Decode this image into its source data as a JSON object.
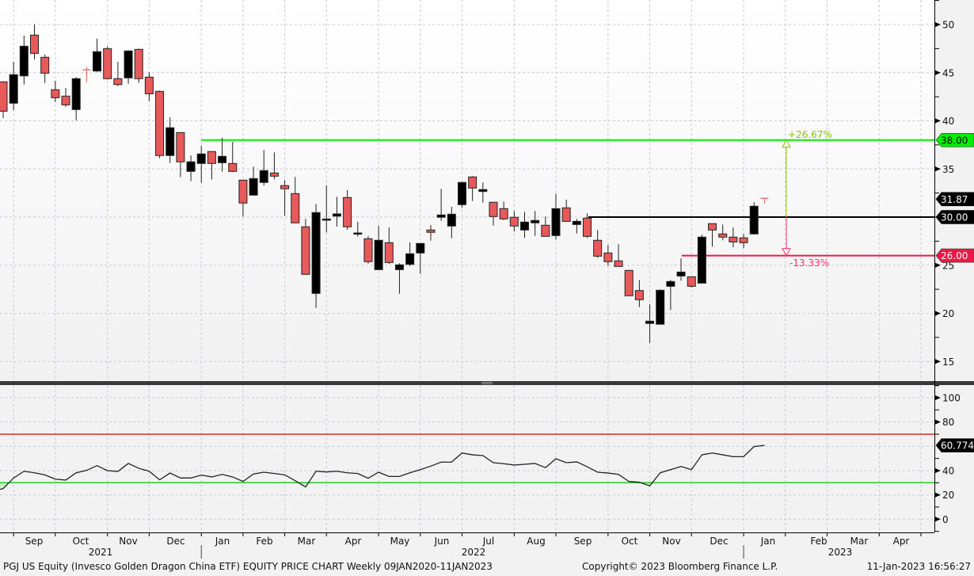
{
  "chart_data": {
    "type": "candlestick",
    "security": "PGJ US Equity (Invesco Golden Dragon China ETF)",
    "frequency": "Weekly",
    "price_panel": {
      "ylim": [
        12.5,
        52.5
      ],
      "y_ticks": [
        "50",
        "45",
        "40",
        "35",
        "25",
        "20",
        "15"
      ],
      "ohlc_columns": [
        "open",
        "high",
        "low",
        "close"
      ],
      "candles": [
        [
          44.05,
          44.1,
          40.3,
          41.0
        ],
        [
          41.83,
          46.13,
          41.11,
          44.79
        ],
        [
          44.67,
          48.85,
          43.77,
          47.75
        ],
        [
          48.9,
          50.0,
          46.4,
          47.01
        ],
        [
          46.6,
          46.87,
          43.93,
          44.95
        ],
        [
          43.23,
          44.16,
          41.96,
          42.4
        ],
        [
          42.57,
          43.42,
          41.46,
          41.66
        ],
        [
          41.17,
          44.54,
          40.04,
          44.38
        ],
        [
          45.3,
          45.6,
          44.0,
          45.25
        ],
        [
          45.17,
          48.52,
          45.09,
          47.18
        ],
        [
          47.5,
          47.75,
          44.3,
          44.38
        ],
        [
          44.38,
          46.13,
          43.6,
          43.77
        ],
        [
          44.46,
          47.3,
          43.85,
          47.26
        ],
        [
          47.42,
          47.5,
          43.93,
          44.38
        ],
        [
          44.54,
          45.04,
          42.04,
          42.81
        ],
        [
          43.06,
          43.14,
          36.12,
          36.4
        ],
        [
          36.4,
          40.37,
          35.62,
          39.28
        ],
        [
          38.78,
          38.8,
          34.14,
          35.74
        ],
        [
          34.75,
          36.4,
          33.73,
          35.74
        ],
        [
          35.57,
          37.41,
          33.56,
          36.56
        ],
        [
          36.81,
          36.81,
          33.9,
          35.57
        ],
        [
          35.65,
          38.23,
          34.72,
          36.31
        ],
        [
          35.57,
          37.82,
          34.67,
          34.75
        ],
        [
          33.84,
          33.84,
          30.06,
          31.46
        ],
        [
          32.28,
          35.24,
          32.28,
          34.0
        ],
        [
          33.6,
          36.97,
          33.27,
          34.83
        ],
        [
          34.58,
          36.72,
          33.93,
          34.25
        ],
        [
          33.27,
          33.84,
          30.14,
          32.94
        ],
        [
          32.44,
          34.17,
          29.4,
          29.4
        ],
        [
          28.99,
          29.81,
          24.0,
          24.05
        ],
        [
          22.07,
          31.37,
          20.56,
          30.47
        ],
        [
          29.7,
          33.3,
          28.4,
          29.8
        ],
        [
          30.1,
          32.12,
          29.01,
          30.33
        ],
        [
          32.03,
          32.8,
          28.68,
          28.99
        ],
        [
          28.3,
          29.5,
          27.97,
          28.35
        ],
        [
          27.75,
          28.02,
          25.17,
          25.37
        ],
        [
          24.54,
          29.1,
          24.54,
          27.59
        ],
        [
          27.34,
          28.93,
          25.14,
          25.28
        ],
        [
          24.54,
          25.2,
          22.04,
          25.04
        ],
        [
          25.09,
          27.37,
          24.92,
          26.19
        ],
        [
          26.27,
          27.26,
          24.1,
          27.26
        ],
        [
          28.66,
          29.18,
          27.56,
          28.42
        ],
        [
          29.98,
          32.94,
          29.61,
          30.22
        ],
        [
          29.07,
          31.07,
          27.8,
          30.3
        ],
        [
          31.29,
          33.68,
          30.96,
          33.6
        ],
        [
          34.17,
          34.25,
          31.67,
          33.02
        ],
        [
          32.66,
          33.6,
          31.5,
          32.86
        ],
        [
          31.54,
          31.54,
          29.12,
          30.06
        ],
        [
          30.88,
          31.62,
          29.7,
          29.81
        ],
        [
          29.98,
          30.63,
          28.5,
          29.07
        ],
        [
          28.66,
          30.55,
          27.84,
          29.48
        ],
        [
          29.4,
          30.63,
          28.05,
          29.65
        ],
        [
          29.15,
          30.06,
          28.0,
          28.0
        ],
        [
          28.08,
          32.44,
          27.67,
          30.88
        ],
        [
          30.96,
          31.81,
          29.56,
          29.56
        ],
        [
          29.23,
          29.81,
          28.3,
          29.56
        ],
        [
          29.89,
          30.39,
          27.84,
          28.0
        ],
        [
          27.59,
          28.66,
          25.78,
          25.94
        ],
        [
          26.27,
          27.1,
          24.95,
          25.37
        ],
        [
          25.45,
          27.18,
          24.87,
          24.87
        ],
        [
          24.46,
          24.5,
          21.8,
          21.83
        ],
        [
          22.37,
          23.47,
          20.64,
          21.42
        ],
        [
          18.95,
          20.92,
          16.94,
          19.19
        ],
        [
          18.87,
          22.49,
          18.87,
          22.4
        ],
        [
          22.81,
          23.47,
          20.35,
          23.31
        ],
        [
          23.88,
          25.7,
          23.39,
          24.29
        ],
        [
          23.8,
          23.8,
          22.7,
          22.81
        ],
        [
          23.14,
          28.16,
          23.1,
          27.92
        ],
        [
          29.32,
          29.32,
          26.93,
          28.66
        ],
        [
          28.25,
          29.23,
          27.59,
          27.92
        ],
        [
          27.92,
          28.91,
          26.85,
          27.42
        ],
        [
          27.84,
          28.25,
          26.77,
          27.34
        ],
        [
          28.25,
          31.54,
          28.2,
          31.13
        ],
        [
          31.95,
          32.0,
          31.4,
          31.87
        ]
      ],
      "up_color": "#000000",
      "down_color": "#e85a5a",
      "levels": [
        {
          "value": 38.0,
          "label": "38.00",
          "color": "#00ee00"
        },
        {
          "value": 30.0,
          "label": "30.00",
          "color": "#000000"
        },
        {
          "value": 26.0,
          "label": "26.00",
          "color": "#ee1848"
        }
      ],
      "last_price": {
        "value": 31.87,
        "label": "31.87"
      },
      "annotations": {
        "up_pct": "+26.67%",
        "down_pct": "-13.33%",
        "up_color": "#8cc400",
        "down_color": "#ff3366"
      }
    },
    "rsi_panel": {
      "ylim": [
        -10,
        110
      ],
      "y_ticks": [
        "100",
        "80",
        "40",
        "20",
        "0"
      ],
      "overbought": 70,
      "oversold": 30,
      "overbought_color": "#dd0000",
      "oversold_color": "#22cc22",
      "values": [
        25.2,
        33.9,
        39.5,
        38.2,
        36.5,
        33.0,
        32.2,
        38.2,
        40.2,
        44.1,
        40.0,
        39.3,
        45.9,
        41.9,
        39.5,
        32.4,
        38.0,
        33.9,
        33.9,
        36.3,
        34.8,
        36.9,
        34.8,
        31.1,
        37.2,
        38.7,
        37.6,
        36.5,
        31.7,
        26.5,
        39.5,
        38.9,
        39.5,
        38.2,
        37.6,
        33.7,
        38.7,
        35.2,
        35.2,
        38.2,
        40.8,
        43.7,
        47.0,
        47.0,
        54.5,
        53.0,
        52.4,
        46.5,
        45.7,
        44.6,
        45.2,
        45.9,
        42.4,
        49.8,
        46.5,
        47.2,
        43.2,
        38.7,
        38.0,
        36.9,
        31.1,
        30.4,
        27.4,
        38.2,
        40.8,
        43.4,
        40.8,
        53.0,
        54.5,
        53.0,
        51.5,
        51.5,
        59.8,
        60.774
      ],
      "last_label": "60.774"
    },
    "x_axis": {
      "months": [
        "Sep",
        "Oct",
        "Nov",
        "Dec",
        "Jan",
        "Feb",
        "Mar",
        "Apr",
        "May",
        "Jun",
        "Jul",
        "Aug",
        "Sep",
        "Oct",
        "Nov",
        "Dec",
        "Jan",
        "Feb",
        "Mar",
        "Apr"
      ],
      "years": [
        "2021",
        "2022",
        "2023"
      ]
    }
  },
  "footer": {
    "title": "PGJ US Equity (Invesco Golden Dragon China ETF) EQUITY PRICE CHART  Weekly 09JAN2020-11JAN2023",
    "copyright": "Copyright© 2023 Bloomberg Finance L.P.",
    "timestamp": "11-Jan-2023 16:56:27"
  }
}
